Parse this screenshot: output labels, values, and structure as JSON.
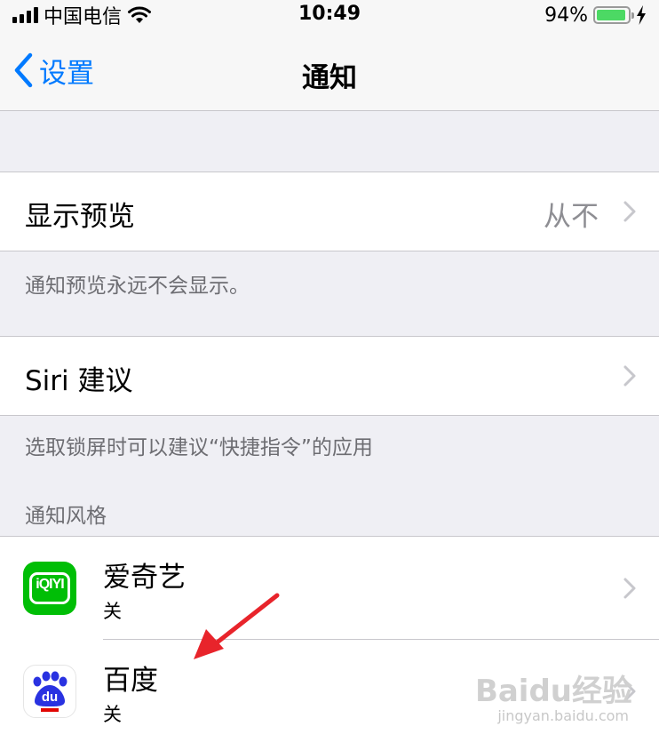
{
  "status": {
    "carrier": "中国电信",
    "time": "10:49",
    "battery_percent": "94%",
    "battery_level": 0.94,
    "icons": [
      "signal-icon",
      "wifi-icon",
      "battery-icon",
      "charging-icon"
    ]
  },
  "nav": {
    "back_label": "设置",
    "title": "通知"
  },
  "settings": {
    "preview": {
      "label": "显示预览",
      "value": "从不",
      "footer": "通知预览永远不会显示。"
    },
    "siri": {
      "label": "Siri 建议",
      "footer": "选取锁屏时可以建议“快捷指令”的应用"
    }
  },
  "section_header": "通知风格",
  "apps": [
    {
      "name": "爱奇艺",
      "status": "关",
      "icon": "iqiyi-icon",
      "icon_text": "iQIYI",
      "color": "#00be06"
    },
    {
      "name": "百度",
      "status": "关",
      "icon": "baidu-paw-icon",
      "icon_text": "du",
      "color": "#2932e1"
    }
  ],
  "watermark": {
    "text": "Baidu经验",
    "sub": "jingyan.baidu.com"
  },
  "colors": {
    "accent": "#007aff",
    "background": "#efeff4",
    "separator": "#c8c7cc",
    "annotation_arrow": "#e8242b"
  }
}
